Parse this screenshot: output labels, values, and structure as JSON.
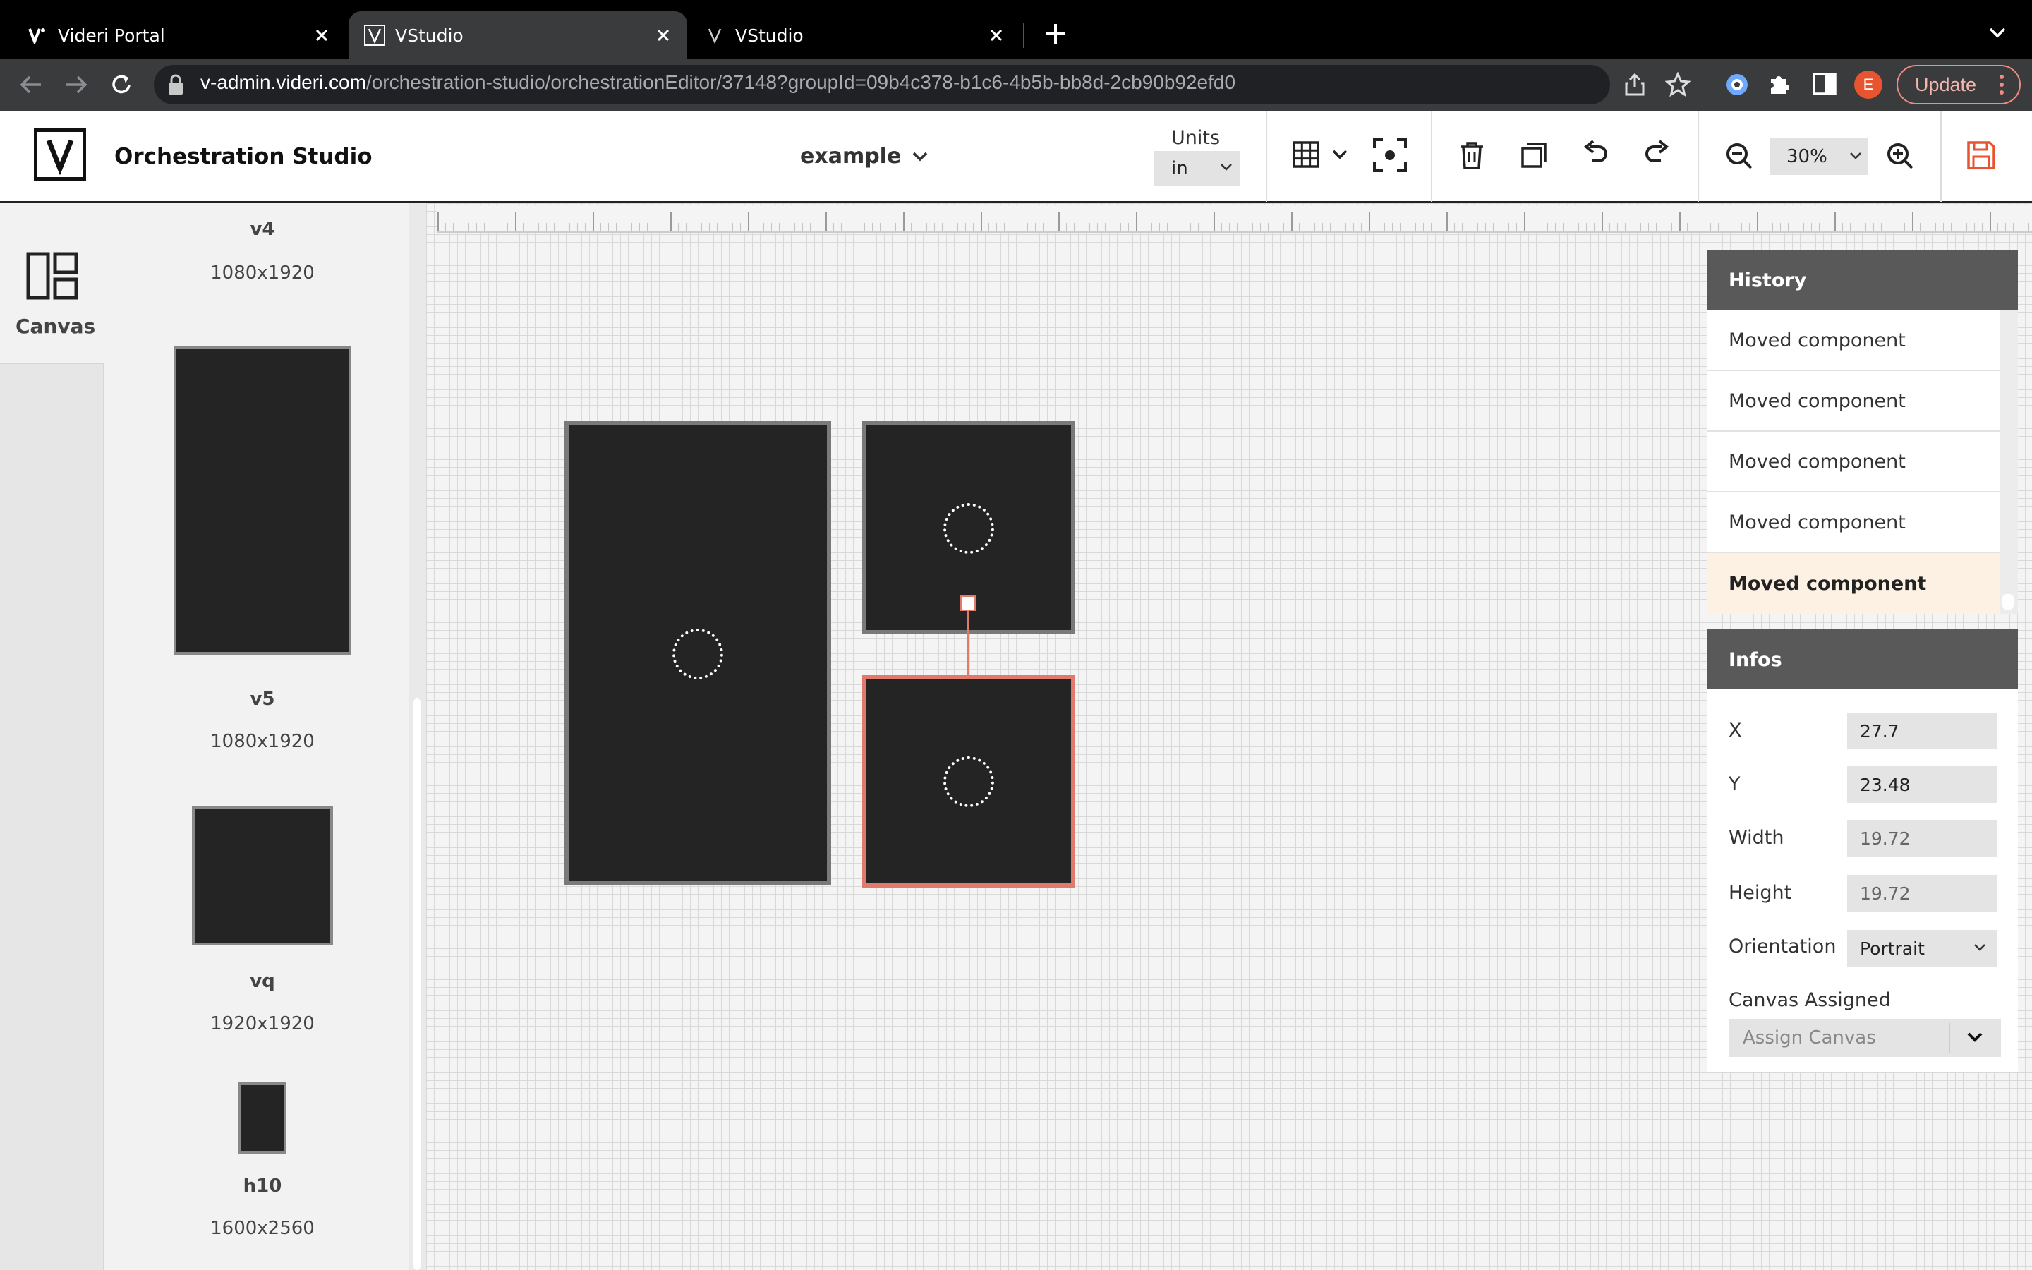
{
  "browser": {
    "tabs": [
      {
        "title": "Videri Portal",
        "active": false
      },
      {
        "title": "VStudio",
        "active": true
      },
      {
        "title": "VStudio",
        "active": false
      }
    ],
    "url_host": "v-admin.videri.com",
    "url_path": "/orchestration-studio/orchestrationEditor/37148?groupId=09b4c378-b1c6-4b5b-bb8d-2cb90b92efd0",
    "profile_initial": "E",
    "update_label": "Update"
  },
  "app": {
    "title": "Orchestration Studio",
    "document_name": "example",
    "units_label": "Units",
    "units_value": "in",
    "zoom_value": "30%",
    "accent_color": "#e8542f"
  },
  "sidebar": {
    "canvas_label": "Canvas"
  },
  "library": [
    {
      "name": "v4",
      "size": "1080x1920"
    },
    {
      "name": "v5",
      "size": "1080x1920"
    },
    {
      "name": "vq",
      "size": "1920x1920"
    },
    {
      "name": "h10",
      "size": "1600x2560"
    }
  ],
  "history": {
    "title": "History",
    "items": [
      "Moved component",
      "Moved component",
      "Moved component",
      "Moved component",
      "Moved component"
    ]
  },
  "infos": {
    "title": "Infos",
    "x_label": "X",
    "x_value": "27.7",
    "y_label": "Y",
    "y_value": "23.48",
    "width_label": "Width",
    "width_value": "19.72",
    "height_label": "Height",
    "height_value": "19.72",
    "orientation_label": "Orientation",
    "orientation_value": "Portrait",
    "canvas_assigned_label": "Canvas Assigned",
    "assign_placeholder": "Assign Canvas"
  }
}
